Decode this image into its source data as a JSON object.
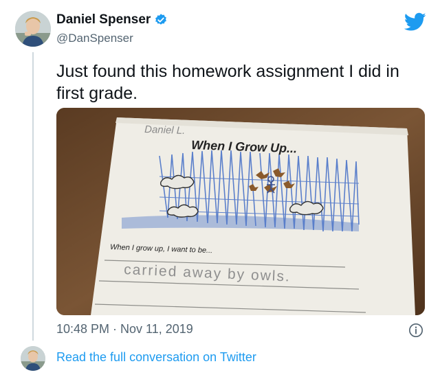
{
  "author": {
    "display_name": "Daniel Spenser",
    "handle": "@DanSpenser",
    "verified": true
  },
  "tweet": {
    "text": "Just found this homework assignment I did in first grade.",
    "timestamp": "10:48 PM · Nov 11, 2019"
  },
  "homework": {
    "name": "Daniel L.",
    "title": "When I Grow Up...",
    "prompt": "When I grow up, I want to be...",
    "answer": "carried away by owls."
  },
  "footer": {
    "link_label": "Read the full conversation on Twitter"
  },
  "colors": {
    "twitter_blue": "#1d9bf0",
    "text_primary": "#0f1419",
    "text_secondary": "#536471",
    "crayon_blue": "#4a73c8"
  },
  "icons": [
    "verified-badge-icon",
    "twitter-bird-icon",
    "info-icon"
  ]
}
